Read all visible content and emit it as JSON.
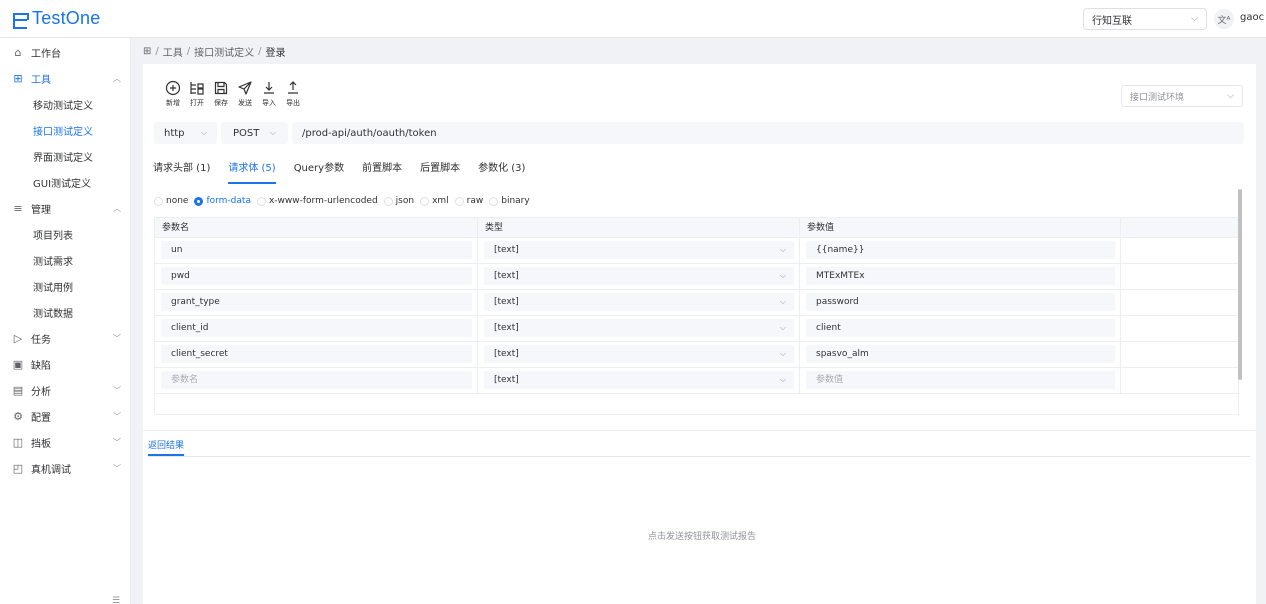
{
  "app": {
    "logo_text": "TestOne",
    "brand_color": "#1a73e8"
  },
  "header": {
    "project": "行知互联",
    "lang_icon": "translate-icon",
    "user": "gaoc"
  },
  "sidebar": {
    "items": [
      {
        "label": "工作台",
        "icon": "home-icon"
      },
      {
        "label": "工具",
        "icon": "grid-icon",
        "expanded": true
      },
      {
        "label": "移动测试定义"
      },
      {
        "label": "接口测试定义",
        "active": true
      },
      {
        "label": "界面测试定义"
      },
      {
        "label": "GUI测试定义"
      },
      {
        "label": "管理",
        "icon": "list-icon",
        "expanded": true
      },
      {
        "label": "项目列表"
      },
      {
        "label": "测试需求"
      },
      {
        "label": "测试用例"
      },
      {
        "label": "测试数据"
      },
      {
        "label": "任务",
        "icon": "play-icon"
      },
      {
        "label": "缺陷",
        "icon": "bug-icon"
      },
      {
        "label": "分析",
        "icon": "calendar-icon"
      },
      {
        "label": "配置",
        "icon": "settings-icon"
      },
      {
        "label": "挡板",
        "icon": "panel-icon"
      },
      {
        "label": "真机调试",
        "icon": "device-icon"
      }
    ],
    "collapse_glyph": "☰"
  },
  "breadcrumb": {
    "home_glyph": "⊞",
    "items": [
      "工具",
      "接口测试定义"
    ],
    "current": "登录",
    "sep": "/"
  },
  "toolbar": {
    "new": "新增",
    "open": "打开",
    "save": "保存",
    "send": "发送",
    "import": "导入",
    "export": "导出"
  },
  "env_select": {
    "placeholder": "接口测试环境"
  },
  "request": {
    "protocol": "http",
    "method": "POST",
    "url": "/prod-api/auth/oauth/token"
  },
  "tabs": [
    {
      "label": "请求头部 (1)"
    },
    {
      "label": "请求体 (5)",
      "active": true
    },
    {
      "label": "Query参数"
    },
    {
      "label": "前置脚本"
    },
    {
      "label": "后置脚本"
    },
    {
      "label": "参数化 (3)"
    }
  ],
  "body_types": [
    "none",
    "form-data",
    "x-www-form-urlencoded",
    "json",
    "xml",
    "raw",
    "binary"
  ],
  "body_type_selected": "form-data",
  "table": {
    "headers": [
      "参数名",
      "类型",
      "参数值"
    ],
    "rows": [
      {
        "name": "un",
        "type": "[text]",
        "value": "{{name}}"
      },
      {
        "name": "pwd",
        "type": "[text]",
        "value": "MTExMTEx"
      },
      {
        "name": "grant_type",
        "type": "[text]",
        "value": "password"
      },
      {
        "name": "client_id",
        "type": "[text]",
        "value": "client"
      },
      {
        "name": "client_secret",
        "type": "[text]",
        "value": "spasvo_alm"
      }
    ],
    "new_row": {
      "name_placeholder": "参数名",
      "type": "[text]",
      "value_placeholder": "参数值"
    }
  },
  "result": {
    "tab": "返回结果",
    "empty": "点击发送按钮获取测试报告"
  }
}
